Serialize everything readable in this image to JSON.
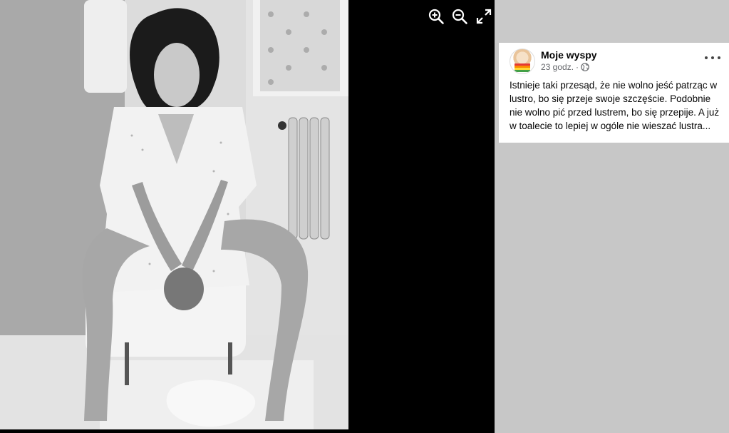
{
  "viewer": {
    "photo_alt": "Black-and-white photograph",
    "tools": [
      {
        "name": "zoom-in",
        "icon": "zoom-in-icon"
      },
      {
        "name": "zoom-out",
        "icon": "zoom-out-icon"
      },
      {
        "name": "fullscreen",
        "icon": "expand-icon"
      }
    ]
  },
  "post": {
    "author": "Moje wyspy",
    "time": "23 godz.",
    "separator": "·",
    "audience_icon": "globe-icon",
    "more_icon": "more-options-icon",
    "text": "Istnieje taki przesąd, że nie wolno jeść patrząc w lustro, bo się przeje swoje szczęście. Podobnie nie wolno pić przed lustrem, bo się przepije. A już w toalecie to lepiej w ogóle nie wieszać lustra..."
  },
  "colors": {
    "panel_bg": "#c7c7c7",
    "card_bg": "#ffffff",
    "text": "#050505",
    "muted": "#65676b"
  }
}
